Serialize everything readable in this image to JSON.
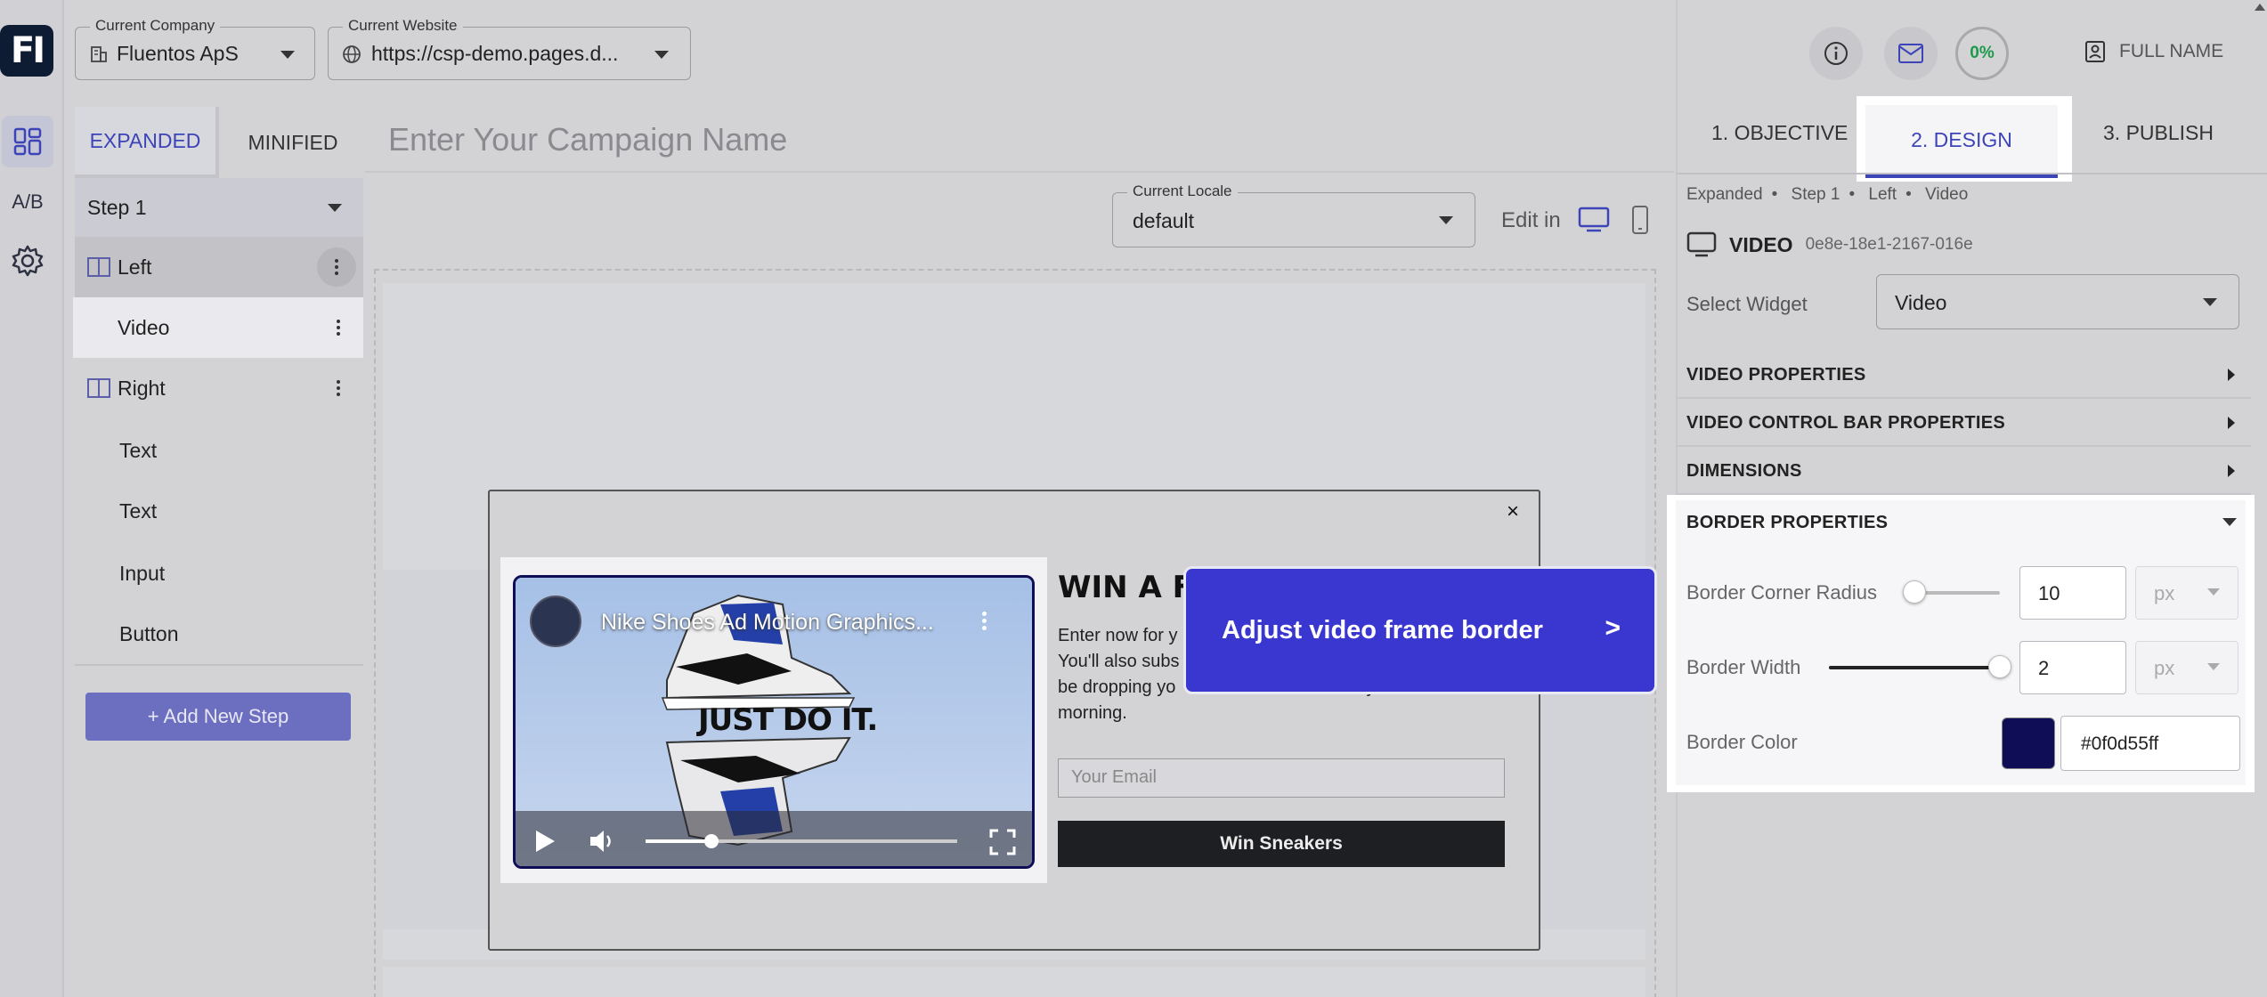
{
  "logo": {
    "text": "FI"
  },
  "rail": {
    "ab_label": "A/B"
  },
  "topbar": {
    "company_label": "Current Company",
    "company_value": "Fluentos ApS",
    "website_label": "Current Website",
    "website_value": "https://csp-demo.pages.d..."
  },
  "steps_panel": {
    "tab_expanded": "EXPANDED",
    "tab_minified": "MINIFIED",
    "step_select": "Step 1",
    "tree": [
      {
        "label": "Left"
      },
      {
        "label": "Video"
      },
      {
        "label": "Right"
      },
      {
        "label": "Text"
      },
      {
        "label": "Text"
      },
      {
        "label": "Input"
      },
      {
        "label": "Button"
      }
    ],
    "add_step": "+ Add New Step"
  },
  "canvas": {
    "campaign_placeholder": "Enter Your Campaign Name",
    "locale_label": "Current Locale",
    "locale_value": "default",
    "edit_in": "Edit in"
  },
  "popup": {
    "close": "×",
    "video_title": "Nike Shoes Ad Motion Graphics...",
    "video_slogan": "JUST DO IT.",
    "video_progress": 0.21,
    "headline": "WIN A F",
    "body_left": "Enter now for y You'll also subs be dropping yo morning.",
    "body_right": "ly",
    "email_placeholder": "Your Email",
    "button": "Win Sneakers"
  },
  "tooltip": {
    "text": "Adjust video frame border",
    "arrow": ">"
  },
  "right_header": {
    "progress": "0%",
    "full_name": "FULL NAME"
  },
  "design_tabs": [
    {
      "label": "1. OBJECTIVE"
    },
    {
      "label": "2. DESIGN"
    },
    {
      "label": "3. PUBLISH"
    }
  ],
  "breadcrumb": [
    "Expanded",
    "Step 1",
    "Left",
    "Video"
  ],
  "widget": {
    "name": "VIDEO",
    "id": "0e8e-18e1-2167-016e",
    "select_label": "Select Widget",
    "select_value": "Video"
  },
  "sections": [
    {
      "title": "VIDEO PROPERTIES"
    },
    {
      "title": "VIDEO CONTROL BAR PROPERTIES"
    },
    {
      "title": "DIMENSIONS"
    },
    {
      "title": "BORDER PROPERTIES"
    }
  ],
  "border": {
    "corner_radius_label": "Border Corner Radius",
    "corner_radius_value": "10",
    "corner_radius_unit": "px",
    "corner_radius_level": 0.0,
    "width_label": "Border Width",
    "width_value": "2",
    "width_unit": "px",
    "width_level": 1.0,
    "color_label": "Border Color",
    "color_value": "#0f0d55ff",
    "color_hex": "#0f0d55"
  },
  "colors": {
    "accent": "#3d44b8",
    "tooltip_bg": "#3a37d1",
    "button_dark": "#1e1f22"
  }
}
